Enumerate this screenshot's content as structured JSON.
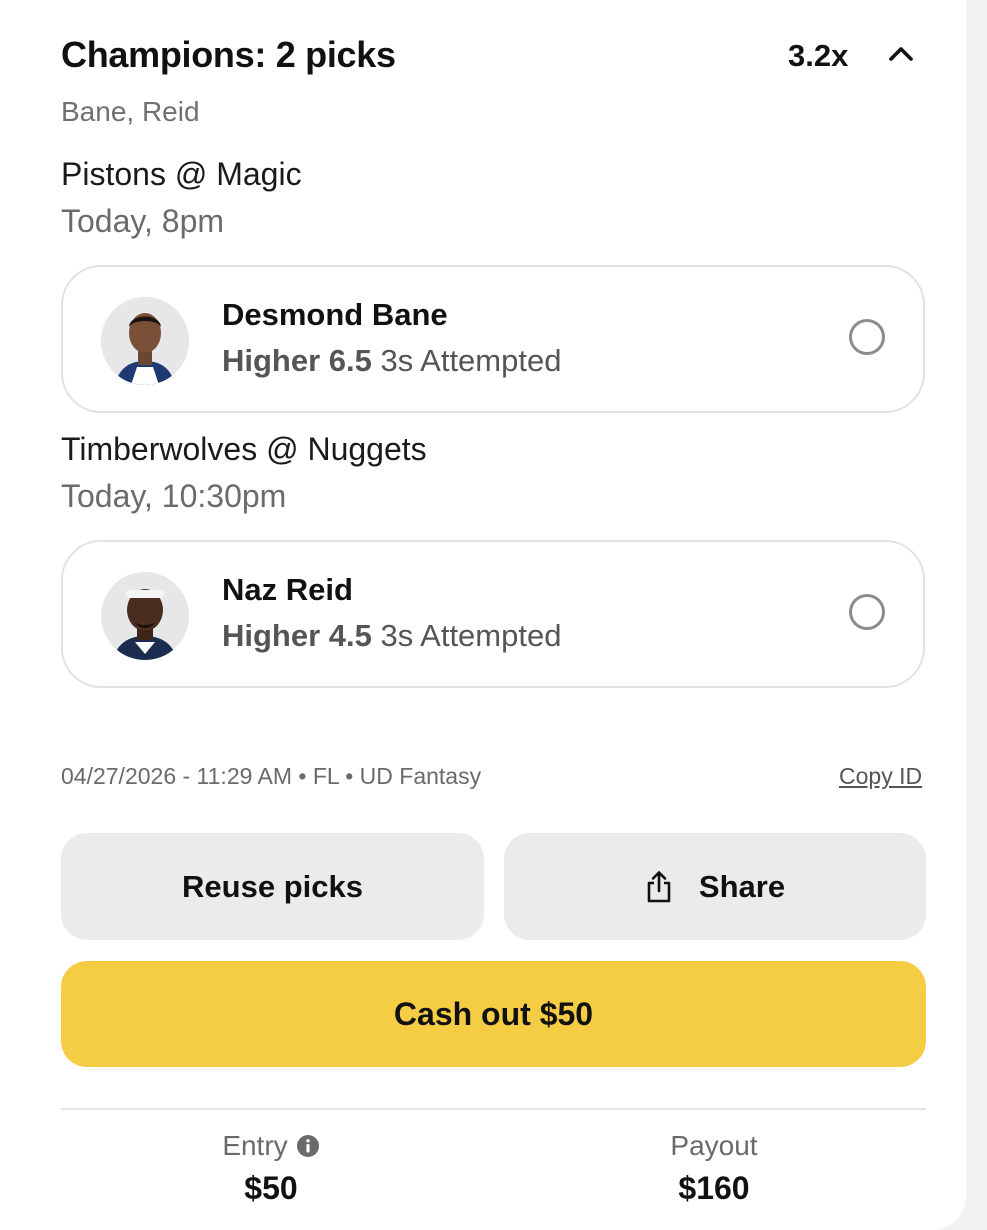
{
  "header": {
    "title": "Champions: 2 picks",
    "multiplier": "3.2x",
    "subtitle": "Bane, Reid"
  },
  "games": [
    {
      "matchup": "Pistons @ Magic",
      "time": "Today, 8pm",
      "pick": {
        "player": "Desmond Bane",
        "direction": "Higher 6.5",
        "stat": "3s Attempted",
        "status": "pending"
      }
    },
    {
      "matchup": "Timberwolves @ Nuggets",
      "time": "Today, 10:30pm",
      "pick": {
        "player": "Naz Reid",
        "direction": "Higher 4.5",
        "stat": "3s Attempted",
        "status": "pending"
      }
    }
  ],
  "meta": {
    "text": "04/27/2026 - 11:29 AM • FL • UD Fantasy",
    "copy_id_label": "Copy ID"
  },
  "actions": {
    "reuse_label": "Reuse picks",
    "share_label": "Share",
    "cashout_label": "Cash out $50"
  },
  "summary": {
    "entry_label": "Entry",
    "entry_value": "$50",
    "payout_label": "Payout",
    "payout_value": "$160"
  },
  "colors": {
    "cashout_bg": "#f5cd45",
    "button_bg": "#ebebeb",
    "card_border": "#e2e2e2"
  },
  "icons": [
    "chevron-up-icon",
    "player-avatar",
    "radio-empty-icon",
    "share-icon",
    "info-icon"
  ]
}
